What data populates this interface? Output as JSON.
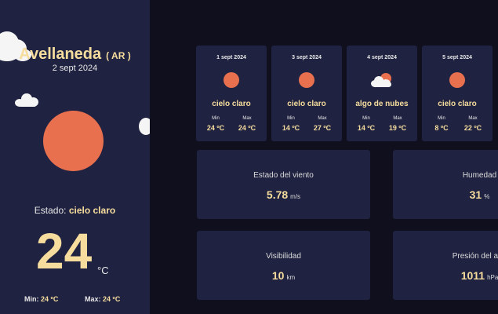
{
  "location": {
    "city": "Avellaneda",
    "country": "( AR )",
    "date": "2 sept 2024"
  },
  "current": {
    "estado_label": "Estado:",
    "estado_value": "cielo claro",
    "temperature": "24",
    "unit": "°C",
    "min_label": "Min:",
    "min_value": "24 ºC",
    "max_label": "Max:",
    "max_value": "24 ºC",
    "icon": "sun-icon"
  },
  "forecast": [
    {
      "date": "1 sept 2024",
      "desc": "cielo claro",
      "min_label": "Min",
      "max_label": "Max",
      "min": "24 ºC",
      "max": "24 ºC",
      "icon": "sun-icon"
    },
    {
      "date": "3 sept 2024",
      "desc": "cielo claro",
      "min_label": "Min",
      "max_label": "Max",
      "min": "14 ºC",
      "max": "27 ºC",
      "icon": "sun-icon"
    },
    {
      "date": "4 sept 2024",
      "desc": "algo de nubes",
      "min_label": "Min",
      "max_label": "Max",
      "min": "14 ºC",
      "max": "19 ºC",
      "icon": "cloud-sun-icon"
    },
    {
      "date": "5 sept 2024",
      "desc": "cielo claro",
      "min_label": "Min",
      "max_label": "Max",
      "min": "8 ºC",
      "max": "22 ºC",
      "icon": "sun-icon"
    }
  ],
  "stats": {
    "wind": {
      "label": "Estado del viento",
      "value": "5.78",
      "unit": "m/s"
    },
    "humidity": {
      "label": "Humedad",
      "value": "31",
      "unit": "%"
    },
    "visibility": {
      "label": "Visibilidad",
      "value": "10",
      "unit": "km"
    },
    "pressure": {
      "label": "Presión del aire",
      "value": "1011",
      "unit": "hPa"
    }
  },
  "colors": {
    "sidebar": "#1f2240",
    "background": "#0f0f1d",
    "accent": "#f6dd9e",
    "sun": "#e9704f"
  }
}
